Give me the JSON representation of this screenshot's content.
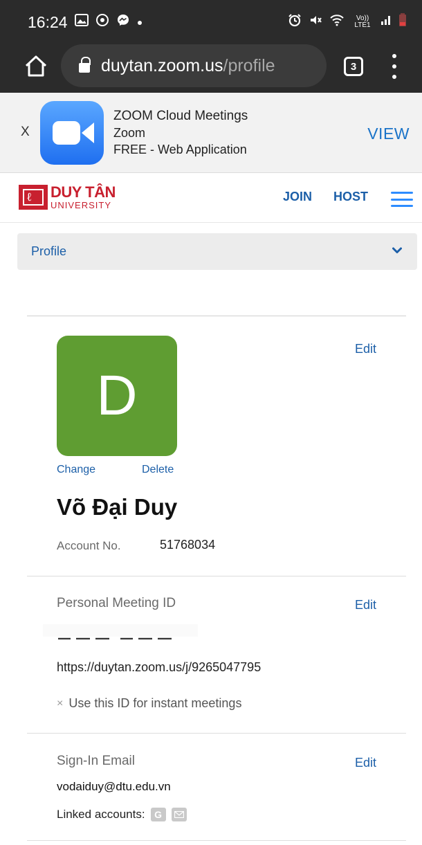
{
  "status_bar": {
    "time": "16:24",
    "left_icons": [
      "gallery-icon",
      "messenger-icon",
      "message-icon",
      "dot-icon"
    ],
    "right_icons": [
      "alarm-icon",
      "mute-icon",
      "wifi-icon",
      "volte-icon",
      "signal-icon",
      "battery-icon"
    ],
    "volte_label": "Vo)) LTE1"
  },
  "browser": {
    "url_host": "duytan.zoom.us",
    "url_path": "/profile",
    "tab_count": "3"
  },
  "app_banner": {
    "close": "X",
    "app_name": "ZOOM Cloud Meetings",
    "developer": "Zoom",
    "price": "FREE - Web Application",
    "view_label": "VIEW"
  },
  "site_header": {
    "logo_title": "DUY TÂN",
    "logo_sub": "UNIVERSITY",
    "join": "JOIN",
    "host": "HOST"
  },
  "dropdown": {
    "label": "Profile"
  },
  "profile": {
    "avatar_letter": "D",
    "change": "Change",
    "delete": "Delete",
    "edit": "Edit",
    "name": "Võ Đại Duy",
    "account_label": "Account No.",
    "account_no": "51768034"
  },
  "pmi": {
    "label": "Personal Meeting ID",
    "edit": "Edit",
    "url": "https://duytan.zoom.us/j/9265047795",
    "instant_icon": "×",
    "instant_text": "Use this ID for instant meetings"
  },
  "signin": {
    "label": "Sign-In Email",
    "edit": "Edit",
    "email": "vodaiduy@dtu.edu.vn",
    "linked_label": "Linked accounts:",
    "linked_accounts": [
      "google-icon",
      "email-icon"
    ]
  },
  "colors": {
    "accent": "#1c5fa8",
    "avatar": "#5f9d32",
    "brand_red": "#c8202f"
  }
}
